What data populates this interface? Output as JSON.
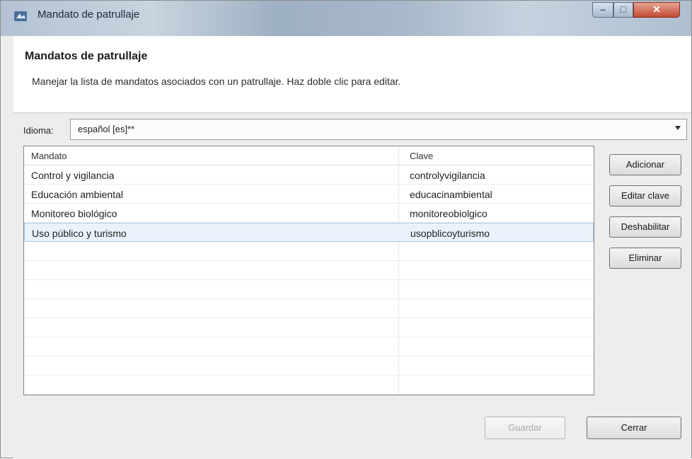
{
  "window": {
    "title": "Mandato de patrullaje"
  },
  "header": {
    "title": "Mandatos de patrullaje",
    "description": "Manejar la lista de mandatos asociados con un patrullaje. Haz doble clic para editar."
  },
  "language": {
    "label": "Idioma:",
    "value": "español [es]**"
  },
  "table": {
    "columns": [
      "Mandato",
      "Clave"
    ],
    "rows": [
      [
        "Control y vigilancia",
        "controlyvigilancia"
      ],
      [
        "Educación ambiental",
        "educacinambiental"
      ],
      [
        "Monitoreo biológico",
        "monitoreobiolgico"
      ],
      [
        "Uso público y turismo",
        "usopblicoyturismo"
      ]
    ],
    "selected_row": 3
  },
  "side_buttons": {
    "add": "Adicionar",
    "edit_key": "Editar clave",
    "disable": "Deshabilitar",
    "delete": "Eliminar"
  },
  "footer": {
    "save": "Guardar",
    "close": "Cerrar"
  }
}
